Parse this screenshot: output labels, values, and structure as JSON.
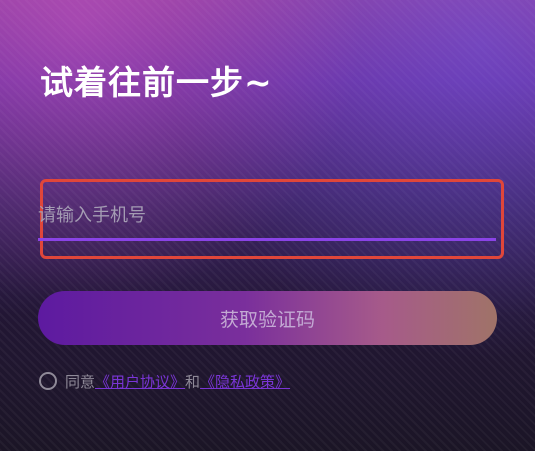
{
  "page": {
    "heading": "试着往前一步~"
  },
  "login": {
    "phone_placeholder": "请输入手机号",
    "get_code_label": "获取验证码"
  },
  "agreement": {
    "agree_text": "同意",
    "user_agreement": "《用户协议》",
    "and_text": "和",
    "privacy_policy": "《隐私政策》"
  },
  "colors": {
    "accent": "#8a43e6",
    "highlight_border": "#e0463a",
    "link": "#7a35d6"
  }
}
